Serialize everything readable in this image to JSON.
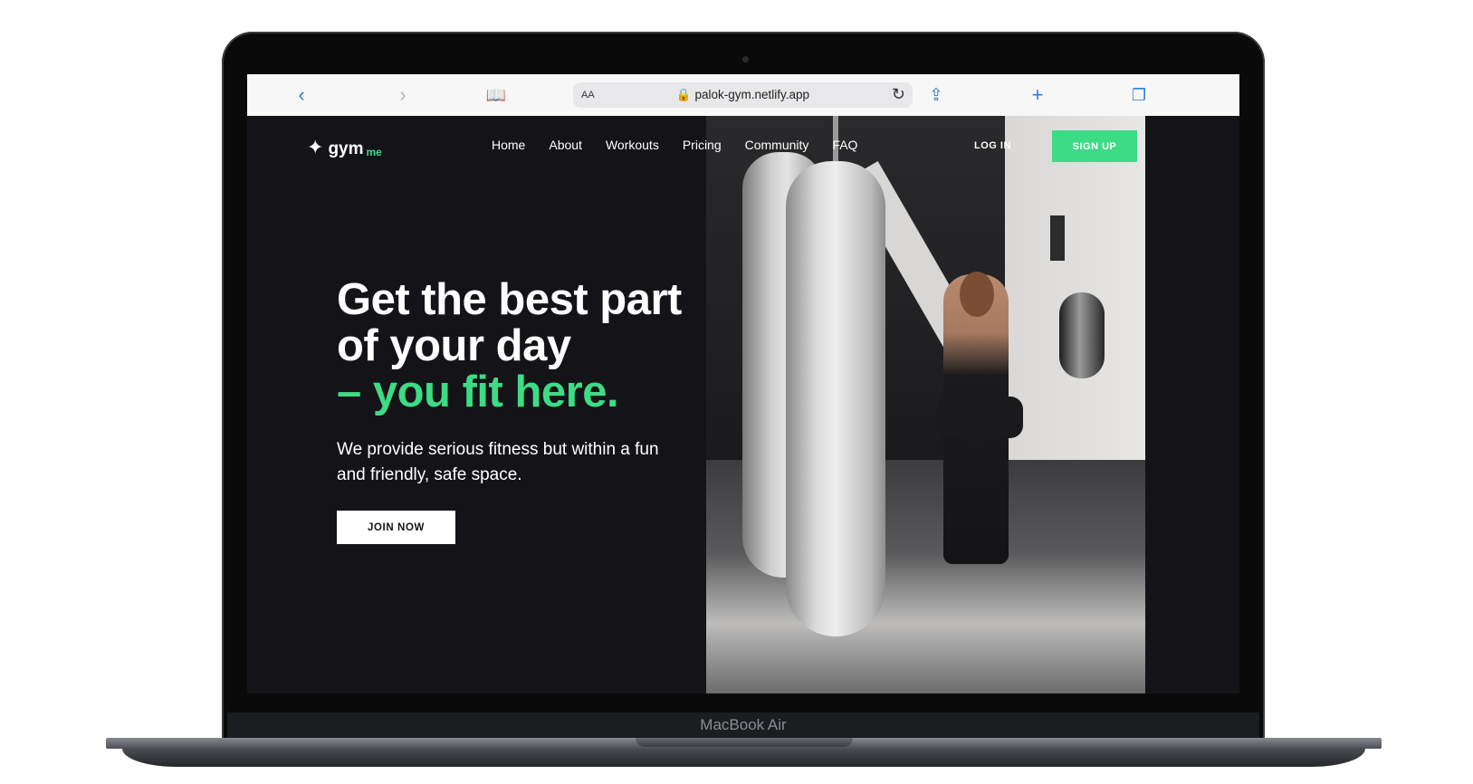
{
  "safari": {
    "back_icon": "chevron-left-icon",
    "forward_icon": "chevron-right-icon",
    "bookmarks_icon": "book-icon",
    "text_size_label": "AA",
    "url": "palok-gym.netlify.app",
    "lock_icon": "lock-icon",
    "reload_icon": "reload-icon",
    "share_icon": "share-icon",
    "new_tab_icon": "plus-icon",
    "tabs_icon": "tabs-icon"
  },
  "site": {
    "logo_main": "gym",
    "logo_sub": "me",
    "nav": [
      "Home",
      "About",
      "Workouts",
      "Pricing",
      "Community",
      "FAQ"
    ],
    "login_label": "LOG IN",
    "signup_label": "SIGN UP"
  },
  "hero": {
    "headline_line1": "Get the best part",
    "headline_line2": "of your day",
    "headline_accent": "– you fit here.",
    "subtext": "We provide serious fitness but within a fun and friendly, safe space.",
    "cta_label": "JOIN NOW",
    "image_subject": "woman boxer beside punching bags in a gym"
  },
  "device": {
    "model_label": "MacBook Air"
  },
  "colors": {
    "accent": "#3ddb84",
    "page_bg": "#141318",
    "safari_blue": "#2b7fe0"
  }
}
